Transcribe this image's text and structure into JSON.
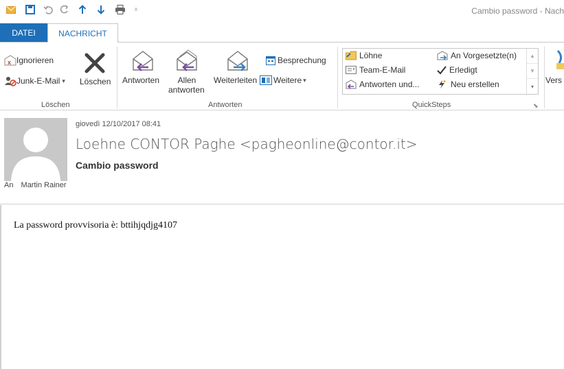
{
  "window": {
    "title": "Cambio password - Nach"
  },
  "tabs": {
    "file": "DATEI",
    "message": "NACHRICHT"
  },
  "ribbon": {
    "delete_group": {
      "label": "Löschen",
      "ignore": "Ignorieren",
      "junk": "Junk-E-Mail",
      "delete": "Löschen"
    },
    "respond_group": {
      "label": "Antworten",
      "reply": "Antworten",
      "reply_all_1": "Allen",
      "reply_all_2": "antworten",
      "forward": "Weiterleiten",
      "meeting": "Besprechung",
      "more": "Weitere"
    },
    "quicksteps": {
      "label": "QuickSteps",
      "items": [
        "Löhne",
        "An Vorgesetzte(n)",
        "Team-E-Mail",
        "Erledigt",
        "Antworten und...",
        "Neu erstellen"
      ]
    },
    "move_partial": "Vers"
  },
  "message": {
    "date": "giovedì 12/10/2017 08:41",
    "from": "Loehne CONTOR Paghe <pagheonline@contor.it>",
    "subject": "Cambio password",
    "to_label": "An",
    "to_name": "Martin Rainer",
    "body": "La password provvisoria è: bttihjqdjg4107"
  },
  "colors": {
    "accent": "#1e6fb8",
    "avatar_bg": "#c8c8c8"
  }
}
